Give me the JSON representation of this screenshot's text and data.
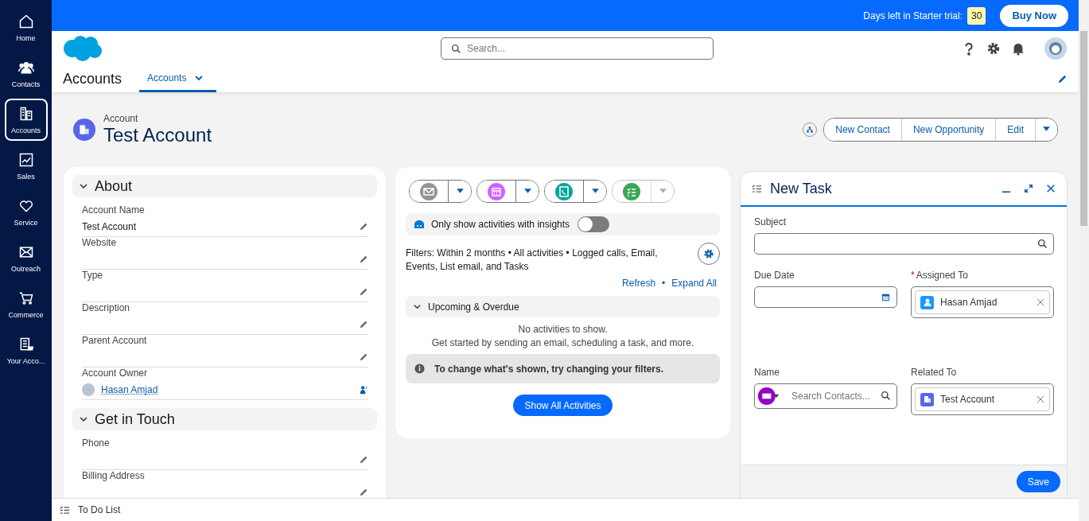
{
  "trial": {
    "label": "Days left in Starter trial:",
    "days": "30",
    "button": "Buy Now"
  },
  "nav": [
    {
      "label": "Home",
      "kind": "home",
      "selected": false
    },
    {
      "label": "Contacts",
      "kind": "contacts",
      "selected": false
    },
    {
      "label": "Accounts",
      "kind": "accounts",
      "selected": true
    },
    {
      "label": "Sales",
      "kind": "sales",
      "selected": false
    },
    {
      "label": "Service",
      "kind": "service",
      "selected": false
    },
    {
      "label": "Outreach",
      "kind": "outreach",
      "selected": false
    },
    {
      "label": "Commerce",
      "kind": "commerce",
      "selected": false
    },
    {
      "label": "Your Acco...",
      "kind": "youraccount",
      "selected": false
    }
  ],
  "header": {
    "search_placeholder": "Search...",
    "app_name": "Accounts",
    "tabs": [
      {
        "label": "Accounts",
        "selected": true
      }
    ]
  },
  "record": {
    "type": "Account",
    "name": "Test Account",
    "actions": [
      "New Contact",
      "New Opportunity",
      "Edit"
    ]
  },
  "sections": [
    {
      "title": "About",
      "expanded": true,
      "fields": [
        {
          "label": "Account Name",
          "value": "Test Account",
          "kind": "text"
        },
        {
          "label": "Website",
          "kind": "text"
        },
        {
          "label": "Type",
          "kind": "text"
        },
        {
          "label": "Description",
          "kind": "text"
        },
        {
          "label": "Parent Account",
          "kind": "text"
        },
        {
          "label": "Account Owner",
          "value": "Hasan Amjad",
          "kind": "user"
        }
      ]
    },
    {
      "title": "Get in Touch",
      "expanded": true,
      "fields": [
        {
          "label": "Phone",
          "kind": "text"
        },
        {
          "label": "Billing Address",
          "kind": "text"
        }
      ]
    }
  ],
  "activity": {
    "composers": [
      {
        "kind": "email",
        "menu_disabled": false
      },
      {
        "kind": "event",
        "menu_disabled": false
      },
      {
        "kind": "call",
        "menu_disabled": false
      },
      {
        "kind": "task",
        "menu_disabled": true
      }
    ],
    "insights": {
      "label": "Only show activities with insights",
      "on": false
    },
    "filters": "Filters: Within 2 months • All activities • Logged calls, Email, Events, List email, and Tasks",
    "links": [
      "Refresh",
      "Expand All"
    ],
    "link_separator": "•",
    "group": {
      "title": "Upcoming & Overdue",
      "expanded": true
    },
    "empty_title": "No activities to show.",
    "empty_hint": "Get started by sending an email, scheduling a task, and more.",
    "notice": "To change what's shown, try changing your filters.",
    "button": "Show All Activities"
  },
  "task_panel": {
    "title": "New Task",
    "fields": [
      {
        "label": "Subject",
        "kind": "lookup"
      },
      {
        "label": "Due Date",
        "kind": "date"
      },
      {
        "label": "Assigned To",
        "kind": "user_pill",
        "value": "Hasan Amjad",
        "required_mark": "*"
      },
      {
        "label": "Name",
        "kind": "polymorphic",
        "placeholder": "Search Contacts..."
      },
      {
        "label": "Related To",
        "kind": "account_pill",
        "value": "Test Account"
      }
    ],
    "save": "Save"
  },
  "utility": {
    "label": "To Do List"
  }
}
